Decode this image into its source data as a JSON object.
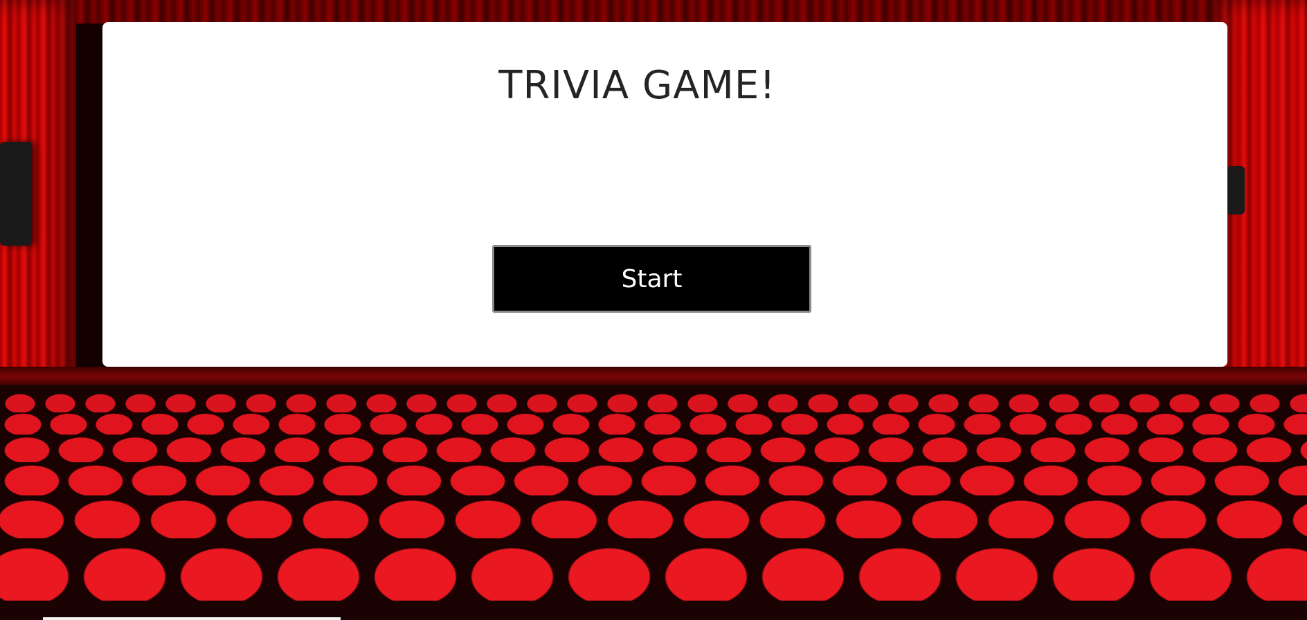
{
  "game": {
    "title": "TRIVIA GAME!",
    "start_label": "Start"
  },
  "colors": {
    "panel_background": "#ffffff",
    "button_background": "#000000",
    "button_text": "#ffffff",
    "title_text": "#222426",
    "curtain_red": "#e0141f"
  },
  "background": {
    "scene": "theater-with-red-curtains-and-red-seats"
  }
}
